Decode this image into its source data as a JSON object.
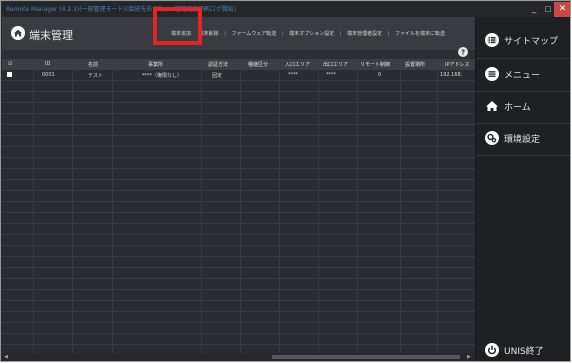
{
  "window": {
    "title": "Remote Manager (4.2.3)(一般管理モード)(接続先名)[フォー管理者][印刷ログ開始]",
    "minimize": "_",
    "maximize": "□",
    "close": "✕"
  },
  "header": {
    "title": "端末管理",
    "home_icon": "home-icon",
    "help_icon": "help-icon"
  },
  "toolbar": {
    "items": [
      {
        "label": "端末追加",
        "highlighted": true
      },
      {
        "label": "端末削除"
      },
      {
        "label": "ファームウェア転送"
      },
      {
        "label": "端末オプション設定"
      },
      {
        "label": "端末管理者設定"
      },
      {
        "label": "ファイルを端末に転送"
      }
    ],
    "highlight_color": "#e0262b"
  },
  "table": {
    "columns": [
      "☑",
      "ID",
      "名前",
      "事業所",
      "認証方法",
      "種継区分",
      "入口エリア",
      "出口エリア",
      "リモート制御",
      "設置場所",
      "IPアドレス"
    ],
    "rows": [
      {
        "checked": false,
        "cells": [
          "",
          "0001",
          "テスト",
          "****（権限なし）",
          "固定",
          "",
          "****",
          "****",
          "0",
          "",
          "192.168."
        ]
      }
    ]
  },
  "sidebar": {
    "items": [
      {
        "label": "サイトマップ",
        "icon": "list-icon"
      },
      {
        "label": "メニュー",
        "icon": "menu-icon"
      },
      {
        "label": "ホーム",
        "icon": "home-icon"
      },
      {
        "label": "環境設定",
        "icon": "gear-icon"
      }
    ],
    "exit_label": "UNIS終了",
    "exit_icon": "power-icon"
  },
  "colors": {
    "background": "#2d2e33",
    "sidebar": "#1f2024",
    "header": "#3a3b40",
    "close_button": "#c64b44"
  }
}
